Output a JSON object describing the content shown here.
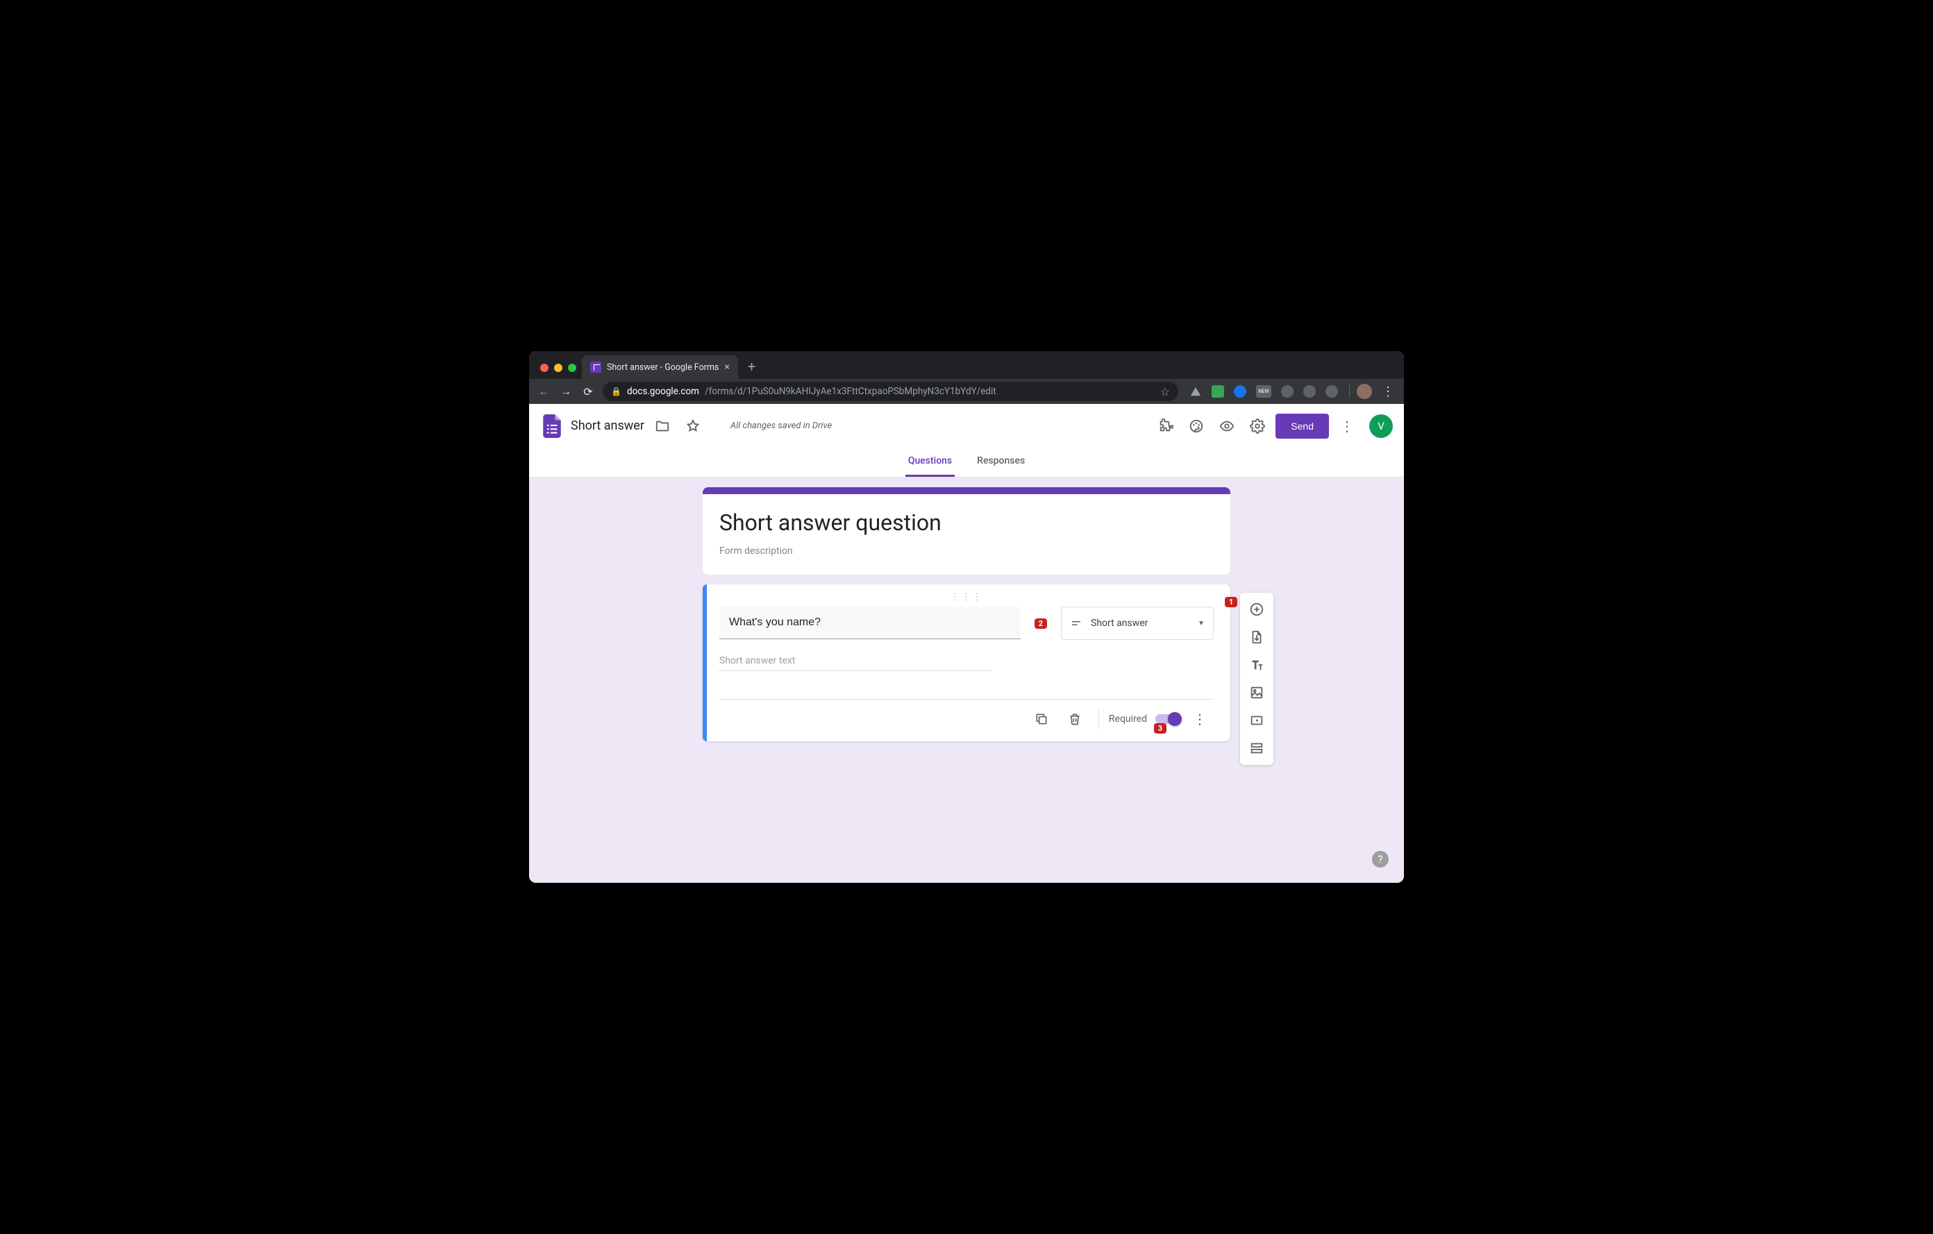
{
  "browser": {
    "tab_title": "Short answer - Google Forms",
    "url_domain": "docs.google.com",
    "url_path": "/forms/d/1PuS0uN9kAHIJyAe1x3FttCtxpaoPSbMphyN3cY1bYdY/edit",
    "new_ext_label": "NEW"
  },
  "header": {
    "doc_title": "Short answer",
    "save_status": "All changes saved in Drive",
    "send_label": "Send",
    "avatar_initial": "V"
  },
  "tabs": {
    "questions": "Questions",
    "responses": "Responses"
  },
  "form": {
    "title": "Short answer question",
    "description_placeholder": "Form description"
  },
  "question": {
    "text": "What's you name?",
    "type_label": "Short answer",
    "answer_placeholder": "Short answer text",
    "required_label": "Required",
    "required_on": true
  },
  "callouts": {
    "one": "1",
    "two": "2",
    "three": "3"
  },
  "help": "?"
}
